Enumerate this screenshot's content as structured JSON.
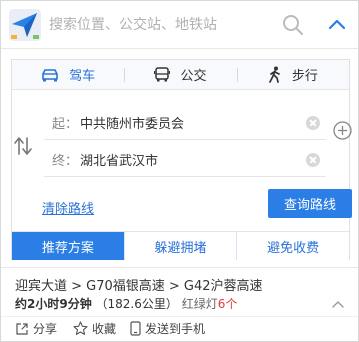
{
  "search": {
    "placeholder": "搜索位置、公交站、地铁站"
  },
  "modes": [
    {
      "label": "驾车",
      "icon": "car-icon",
      "active": true
    },
    {
      "label": "公交",
      "icon": "bus-icon",
      "active": false
    },
    {
      "label": "步行",
      "icon": "walk-icon",
      "active": false
    }
  ],
  "route": {
    "start_label": "起：",
    "start_value": "中共随州市委员会",
    "end_label": "终：",
    "end_value": "湖北省武汉市"
  },
  "clear_route_label": "清除路线",
  "query_button_label": "查询路线",
  "plan_tabs": [
    "推荐方案",
    "躲避拥堵",
    "避免收费"
  ],
  "result": {
    "route": "迎宾大道 > G70福银高速 > G42沪蓉高速",
    "duration": "约2小时9分钟",
    "distance": "（182.6公里）",
    "lights_label": "红绿灯",
    "lights_count": "6个"
  },
  "actions": {
    "share": "分享",
    "favorite": "收藏",
    "send_to_phone": "发送到手机"
  },
  "colors": {
    "accent": "#2a7ee6",
    "link": "#2a72d8",
    "alert": "#e23a3a"
  }
}
